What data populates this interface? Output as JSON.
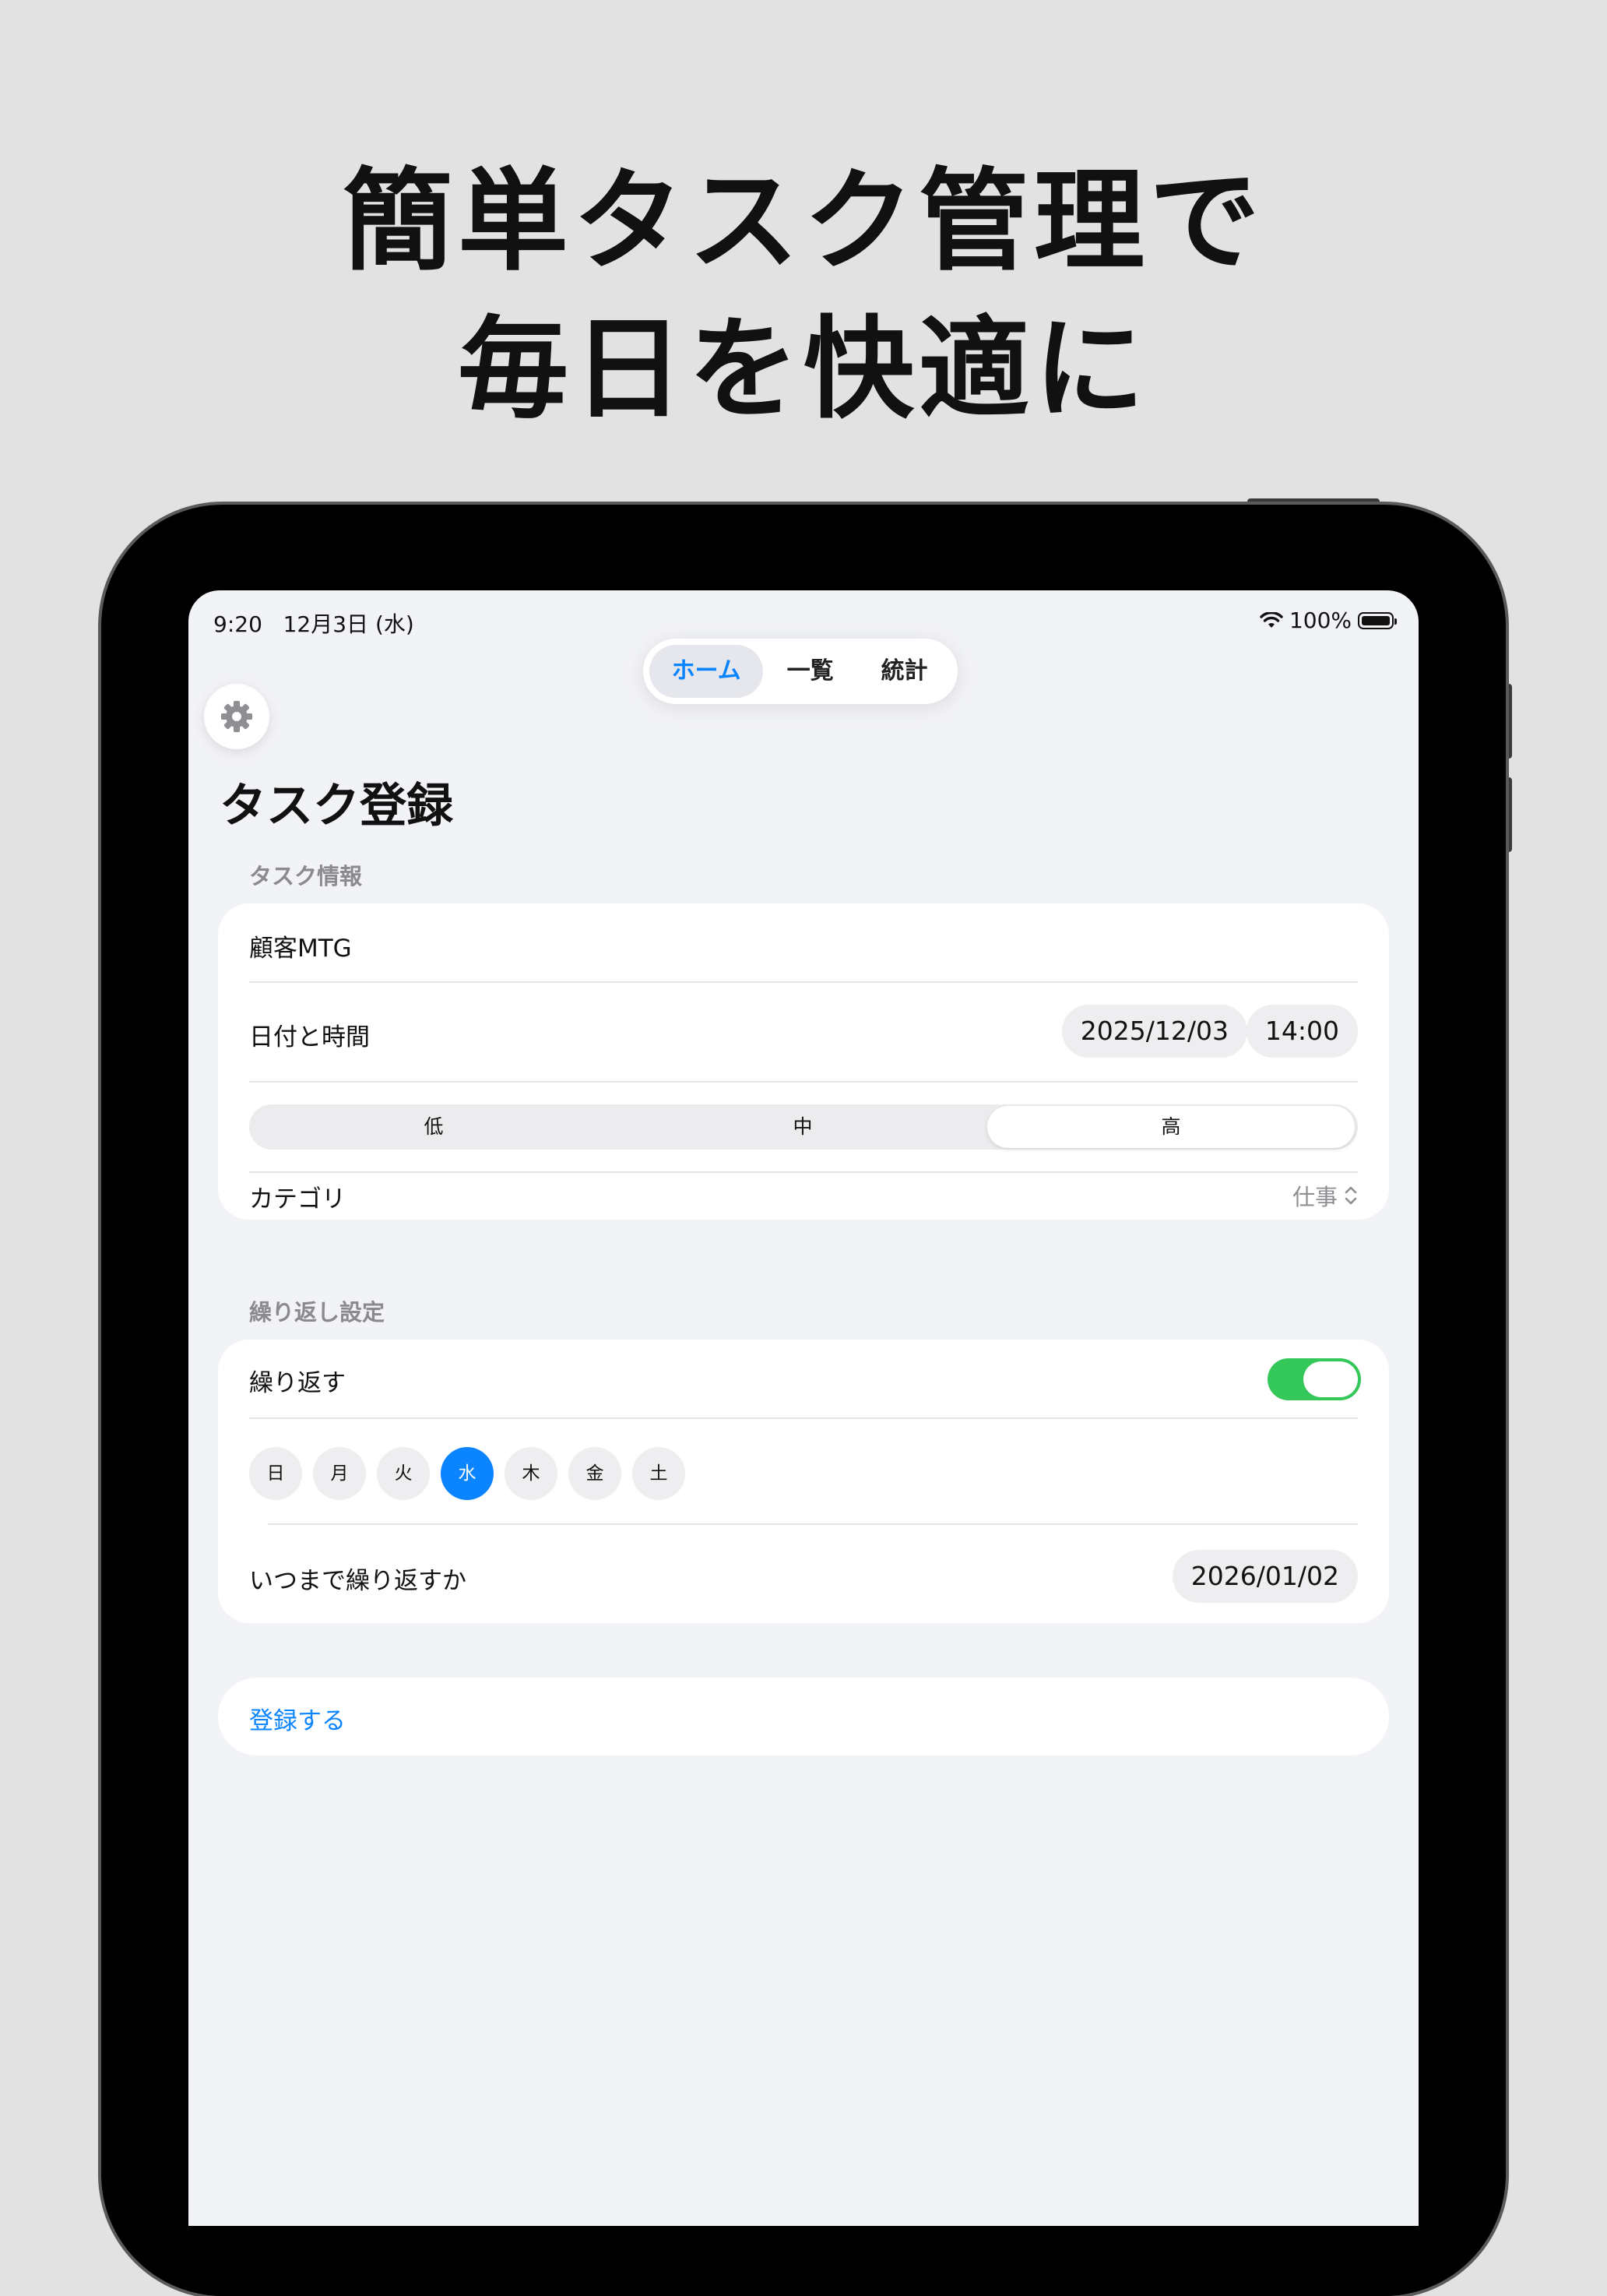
{
  "headline": {
    "line1": "簡単タスク管理で",
    "line2": "毎日を快適に"
  },
  "status_bar": {
    "time": "9:20",
    "date": "12月3日 (水)",
    "battery": "100%"
  },
  "tabs": [
    {
      "label": "ホーム",
      "active": true
    },
    {
      "label": "一覧",
      "active": false
    },
    {
      "label": "統計",
      "active": false
    }
  ],
  "page_title": "タスク登録",
  "task_info": {
    "section_label": "タスク情報",
    "title_value": "顧客MTG",
    "datetime_label": "日付と時間",
    "date_value": "2025/12/03",
    "time_value": "14:00",
    "priority_options": [
      "低",
      "中",
      "高"
    ],
    "priority_selected": "高",
    "category_label": "カテゴリ",
    "category_value": "仕事"
  },
  "repeat": {
    "section_label": "繰り返し設定",
    "toggle_label": "繰り返す",
    "toggle_on": true,
    "days": [
      "日",
      "月",
      "火",
      "水",
      "木",
      "金",
      "土"
    ],
    "selected_day": "水",
    "until_label": "いつまで繰り返すか",
    "until_value": "2026/01/02"
  },
  "register_button": "登録する",
  "colors": {
    "accent": "#0a84ff",
    "toggle": "#34c759",
    "background": "#f2f3f7"
  }
}
